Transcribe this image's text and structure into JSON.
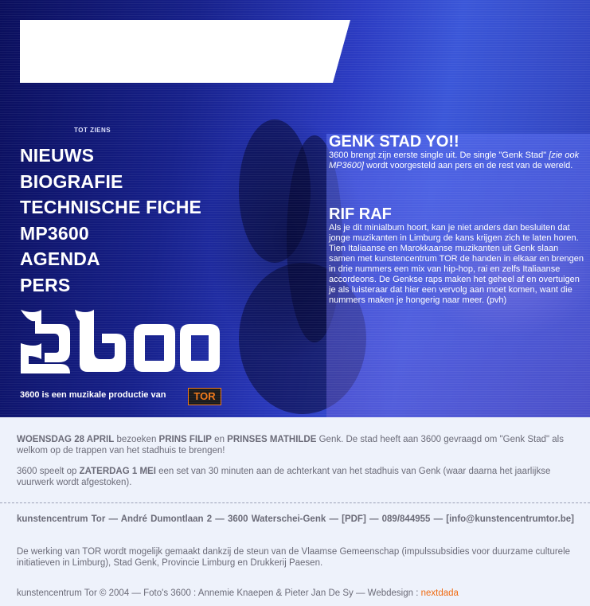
{
  "nav": {
    "items": [
      "NIEUWS",
      "BIOGRAFIE",
      "TECHNISCHE FICHE",
      "MP3600",
      "AGENDA",
      "PERS"
    ]
  },
  "hero": {
    "sign_text": "TOT ZIENS",
    "logo_text": "3600",
    "production_text": "3600 is een muzikale productie van",
    "tor_logo": "TOR"
  },
  "news": [
    {
      "title": "GENK STAD YO!!",
      "body_part1": "3600 brengt zijn eerste single uit. De single \"Genk Stad\" ",
      "body_link": "[zie ook MP3600]",
      "body_part2": " wordt voorgesteld aan pers en de rest van de wereld."
    },
    {
      "title": "RIF RAF",
      "body": "Als je dit minialbum hoort, kan je niet anders dan besluiten dat jonge muzikanten in Limburg de kans krijgen zich te laten horen. Tien Italiaanse en Marokkaanse muzikanten uit Genk slaan samen met kunstencentrum TOR de handen in elkaar en brengen in drie nummers een mix van hip-hop, rai en zelfs Italiaanse accordeons. De Genkse raps maken het geheel af en overtuigen je als luisteraar dat hier een vervolg aan moet komen, want die nummers maken je hongerig naar meer. (pvh)"
    }
  ],
  "announcements": {
    "p1": {
      "date": "WOENSDAG 28 APRIL",
      "t1": " bezoeken ",
      "name1": "PRINS FILIP",
      "t2": " en ",
      "name2": "PRINSES MATHILDE",
      "t3": " Genk. De stad heeft aan 3600 gevraagd om \"Genk Stad\" als welkom op de trappen van het stadhuis te brengen!"
    },
    "p2": {
      "t1": "3600 speelt op ",
      "date": "ZATERDAG 1 MEI",
      "t2": " een set van 30 minuten aan de achterkant van het stadhuis van Genk (waar daarna het jaarlijkse vuurwerk wordt afgestoken)."
    }
  },
  "footer": {
    "contact": "kunstencentrum Tor — André Dumontlaan 2 — 3600 Waterschei-Genk",
    "pdf_label": "PDF",
    "phone": "089/844955",
    "email": "info@kunstencentrumtor.be",
    "support": "De werking van TOR wordt mogelijk gemaakt dankzij de steun van de Vlaamse Gemeenschap (impulssubsidies voor duurzame culturele initiatieven in Limburg), Stad Genk, Provincie Limburg en Drukkerij Paesen.",
    "credits": "kunstencentrum Tor © 2004 — Foto's 3600 : Annemie Knaepen & Pieter Jan De Sy — Webdesign : ",
    "webdesign_link": "nextdada"
  },
  "colors": {
    "accent_orange": "#f06a10",
    "hero_blue": "#2b3bc2",
    "text_gray": "#6b6b78",
    "page_bg": "#eef2fb"
  }
}
